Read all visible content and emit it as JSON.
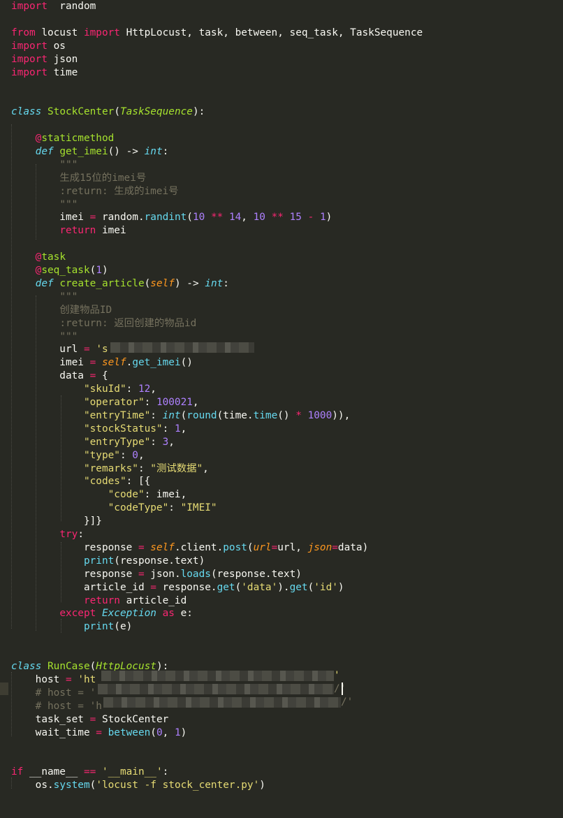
{
  "code_lines": [
    {
      "tokens": [
        [
          "kw",
          "import"
        ],
        [
          "",
          "  random"
        ]
      ]
    },
    {
      "tokens": []
    },
    {
      "tokens": [
        [
          "kw",
          "from"
        ],
        [
          "",
          " locust "
        ],
        [
          "kw",
          "import"
        ],
        [
          "",
          " HttpLocust, task, between, seq_task, TaskSequence"
        ]
      ]
    },
    {
      "tokens": [
        [
          "kw",
          "import"
        ],
        [
          "",
          " os"
        ]
      ]
    },
    {
      "tokens": [
        [
          "kw",
          "import"
        ],
        [
          "",
          " json"
        ]
      ]
    },
    {
      "tokens": [
        [
          "kw",
          "import"
        ],
        [
          "",
          " time"
        ]
      ]
    },
    {
      "tokens": []
    },
    {
      "tokens": []
    },
    {
      "tokens": [
        [
          "def",
          "class"
        ],
        [
          "",
          " "
        ],
        [
          "fn",
          "StockCenter"
        ],
        [
          "",
          "("
        ],
        [
          "ital",
          "TaskSequence"
        ],
        [
          "",
          "):"
        ]
      ]
    },
    {
      "tokens": []
    },
    {
      "tokens": [
        [
          "",
          "    "
        ],
        [
          "dec",
          "@"
        ],
        [
          "fn",
          "staticmethod"
        ]
      ]
    },
    {
      "tokens": [
        [
          "",
          "    "
        ],
        [
          "def",
          "def"
        ],
        [
          "",
          " "
        ],
        [
          "fn",
          "get_imei"
        ],
        [
          "",
          "() -> "
        ],
        [
          "def",
          "int"
        ],
        [
          "",
          ":"
        ]
      ]
    },
    {
      "tokens": [
        [
          "",
          "        "
        ],
        [
          "doc",
          "\"\"\""
        ]
      ]
    },
    {
      "tokens": [
        [
          "",
          "        "
        ],
        [
          "doc",
          "生成15位的imei号"
        ]
      ]
    },
    {
      "tokens": [
        [
          "",
          "        "
        ],
        [
          "doc",
          ":return: 生成的imei号"
        ]
      ]
    },
    {
      "tokens": [
        [
          "",
          "        "
        ],
        [
          "doc",
          "\"\"\""
        ]
      ]
    },
    {
      "tokens": [
        [
          "",
          "        imei "
        ],
        [
          "op",
          "="
        ],
        [
          "",
          " random."
        ],
        [
          "bi",
          "randint"
        ],
        [
          "",
          "("
        ],
        [
          "num",
          "10"
        ],
        [
          "",
          " "
        ],
        [
          "op",
          "**"
        ],
        [
          "",
          " "
        ],
        [
          "num",
          "14"
        ],
        [
          "",
          ", "
        ],
        [
          "num",
          "10"
        ],
        [
          "",
          " "
        ],
        [
          "op",
          "**"
        ],
        [
          "",
          " "
        ],
        [
          "num",
          "15"
        ],
        [
          "",
          " "
        ],
        [
          "op",
          "-"
        ],
        [
          "",
          " "
        ],
        [
          "num",
          "1"
        ],
        [
          "",
          ")"
        ]
      ]
    },
    {
      "tokens": [
        [
          "",
          "        "
        ],
        [
          "kw",
          "return"
        ],
        [
          "",
          " imei"
        ]
      ]
    },
    {
      "tokens": []
    },
    {
      "tokens": [
        [
          "",
          "    "
        ],
        [
          "dec",
          "@"
        ],
        [
          "fn",
          "task"
        ]
      ]
    },
    {
      "tokens": [
        [
          "",
          "    "
        ],
        [
          "dec",
          "@"
        ],
        [
          "fn",
          "seq_task"
        ],
        [
          "",
          "("
        ],
        [
          "num",
          "1"
        ],
        [
          "",
          ")"
        ]
      ]
    },
    {
      "tokens": [
        [
          "",
          "    "
        ],
        [
          "def",
          "def"
        ],
        [
          "",
          " "
        ],
        [
          "fn",
          "create_article"
        ],
        [
          "",
          "("
        ],
        [
          "param",
          "self"
        ],
        [
          "",
          ") -> "
        ],
        [
          "def",
          "int"
        ],
        [
          "",
          ":"
        ]
      ]
    },
    {
      "tokens": [
        [
          "",
          "        "
        ],
        [
          "doc",
          "\"\"\""
        ]
      ]
    },
    {
      "tokens": [
        [
          "",
          "        "
        ],
        [
          "doc",
          "创建物品ID"
        ]
      ]
    },
    {
      "tokens": [
        [
          "",
          "        "
        ],
        [
          "doc",
          ":return: 返回创建的物品id"
        ]
      ]
    },
    {
      "tokens": [
        [
          "",
          "        "
        ],
        [
          "doc",
          "\"\"\""
        ]
      ]
    },
    {
      "tokens": [
        [
          "",
          "        url "
        ],
        [
          "op",
          "="
        ],
        [
          "",
          " "
        ],
        [
          "str",
          "'s"
        ]
      ]
    },
    {
      "tokens": [
        [
          "",
          "        imei "
        ],
        [
          "op",
          "="
        ],
        [
          "",
          " "
        ],
        [
          "self",
          "self"
        ],
        [
          "",
          "."
        ],
        [
          "bi",
          "get_imei"
        ],
        [
          "",
          "()"
        ]
      ]
    },
    {
      "tokens": [
        [
          "",
          "        data "
        ],
        [
          "op",
          "="
        ],
        [
          "",
          " {"
        ]
      ]
    },
    {
      "tokens": [
        [
          "",
          "            "
        ],
        [
          "str",
          "\"skuId\""
        ],
        [
          "",
          ": "
        ],
        [
          "num",
          "12"
        ],
        [
          "",
          ","
        ]
      ]
    },
    {
      "tokens": [
        [
          "",
          "            "
        ],
        [
          "str",
          "\"operator\""
        ],
        [
          "",
          ": "
        ],
        [
          "num",
          "100021"
        ],
        [
          "",
          ","
        ]
      ]
    },
    {
      "tokens": [
        [
          "",
          "            "
        ],
        [
          "str",
          "\"entryTime\""
        ],
        [
          "",
          ": "
        ],
        [
          "def",
          "int"
        ],
        [
          "",
          "("
        ],
        [
          "bi",
          "round"
        ],
        [
          "",
          "(time."
        ],
        [
          "bi",
          "time"
        ],
        [
          "",
          "() "
        ],
        [
          "op",
          "*"
        ],
        [
          "",
          " "
        ],
        [
          "num",
          "1000"
        ],
        [
          "",
          ")),"
        ]
      ]
    },
    {
      "tokens": [
        [
          "",
          "            "
        ],
        [
          "str",
          "\"stockStatus\""
        ],
        [
          "",
          ": "
        ],
        [
          "num",
          "1"
        ],
        [
          "",
          ","
        ]
      ]
    },
    {
      "tokens": [
        [
          "",
          "            "
        ],
        [
          "str",
          "\"entryType\""
        ],
        [
          "",
          ": "
        ],
        [
          "num",
          "3"
        ],
        [
          "",
          ","
        ]
      ]
    },
    {
      "tokens": [
        [
          "",
          "            "
        ],
        [
          "str",
          "\"type\""
        ],
        [
          "",
          ": "
        ],
        [
          "num",
          "0"
        ],
        [
          "",
          ","
        ]
      ]
    },
    {
      "tokens": [
        [
          "",
          "            "
        ],
        [
          "str",
          "\"remarks\""
        ],
        [
          "",
          ": "
        ],
        [
          "str",
          "\"测试数据\""
        ],
        [
          "",
          ","
        ]
      ]
    },
    {
      "tokens": [
        [
          "",
          "            "
        ],
        [
          "str",
          "\"codes\""
        ],
        [
          "",
          ": [{"
        ]
      ]
    },
    {
      "tokens": [
        [
          "",
          "                "
        ],
        [
          "str",
          "\"code\""
        ],
        [
          "",
          ": imei,"
        ]
      ]
    },
    {
      "tokens": [
        [
          "",
          "                "
        ],
        [
          "str",
          "\"codeType\""
        ],
        [
          "",
          ": "
        ],
        [
          "str",
          "\"IMEI\""
        ]
      ]
    },
    {
      "tokens": [
        [
          "",
          "            }]}"
        ]
      ]
    },
    {
      "tokens": [
        [
          "",
          "        "
        ],
        [
          "kw",
          "try"
        ],
        [
          "",
          ":"
        ]
      ]
    },
    {
      "tokens": [
        [
          "",
          "            response "
        ],
        [
          "op",
          "="
        ],
        [
          "",
          " "
        ],
        [
          "self",
          "self"
        ],
        [
          "",
          ".client."
        ],
        [
          "bi",
          "post"
        ],
        [
          "",
          "("
        ],
        [
          "param",
          "url"
        ],
        [
          "op",
          "="
        ],
        [
          "",
          "url, "
        ],
        [
          "param",
          "json"
        ],
        [
          "op",
          "="
        ],
        [
          "",
          "data)"
        ]
      ]
    },
    {
      "tokens": [
        [
          "",
          "            "
        ],
        [
          "bi",
          "print"
        ],
        [
          "",
          "(response.text)"
        ]
      ]
    },
    {
      "tokens": [
        [
          "",
          "            response "
        ],
        [
          "op",
          "="
        ],
        [
          "",
          " json."
        ],
        [
          "bi",
          "loads"
        ],
        [
          "",
          "(response.text)"
        ]
      ]
    },
    {
      "tokens": [
        [
          "",
          "            article_id "
        ],
        [
          "op",
          "="
        ],
        [
          "",
          " response."
        ],
        [
          "bi",
          "get"
        ],
        [
          "",
          "("
        ],
        [
          "str",
          "'data'"
        ],
        [
          "",
          ")."
        ],
        [
          "bi",
          "get"
        ],
        [
          "",
          "("
        ],
        [
          "str",
          "'id'"
        ],
        [
          "",
          ")"
        ]
      ]
    },
    {
      "tokens": [
        [
          "",
          "            "
        ],
        [
          "kw",
          "return"
        ],
        [
          "",
          " article_id"
        ]
      ]
    },
    {
      "tokens": [
        [
          "",
          "        "
        ],
        [
          "kw",
          "except"
        ],
        [
          "",
          " "
        ],
        [
          "def",
          "Exception"
        ],
        [
          "",
          " "
        ],
        [
          "kw",
          "as"
        ],
        [
          "",
          " e:"
        ]
      ]
    },
    {
      "tokens": [
        [
          "",
          "            "
        ],
        [
          "bi",
          "print"
        ],
        [
          "",
          "(e)"
        ]
      ]
    },
    {
      "tokens": []
    },
    {
      "tokens": []
    },
    {
      "tokens": [
        [
          "def",
          "class"
        ],
        [
          "",
          " "
        ],
        [
          "fn",
          "RunCase"
        ],
        [
          "",
          "("
        ],
        [
          "ital",
          "HttpLocust"
        ],
        [
          "",
          "):"
        ]
      ]
    },
    {
      "tokens": [
        [
          "",
          "    host "
        ],
        [
          "op",
          "="
        ],
        [
          "",
          " "
        ],
        [
          "str",
          "'ht"
        ]
      ]
    },
    {
      "tokens": [
        [
          "",
          "    "
        ],
        [
          "com",
          "# host = '"
        ]
      ]
    },
    {
      "tokens": [
        [
          "",
          "    "
        ],
        [
          "com",
          "# host = 'h"
        ]
      ]
    },
    {
      "tokens": [
        [
          "",
          "    task_set "
        ],
        [
          "op",
          "="
        ],
        [
          "",
          " StockCenter"
        ]
      ]
    },
    {
      "tokens": [
        [
          "",
          "    wait_time "
        ],
        [
          "op",
          "="
        ],
        [
          "",
          " "
        ],
        [
          "bi",
          "between"
        ],
        [
          "",
          "("
        ],
        [
          "num",
          "0"
        ],
        [
          "",
          ", "
        ],
        [
          "num",
          "1"
        ],
        [
          "",
          ")"
        ]
      ]
    },
    {
      "tokens": []
    },
    {
      "tokens": []
    },
    {
      "tokens": [
        [
          "kw",
          "if"
        ],
        [
          "",
          " __name__ "
        ],
        [
          "op",
          "=="
        ],
        [
          "",
          " "
        ],
        [
          "str",
          "'__main__'"
        ],
        [
          "",
          ":"
        ]
      ]
    },
    {
      "tokens": [
        [
          "",
          "    os."
        ],
        [
          "bi",
          "system"
        ],
        [
          "",
          "("
        ],
        [
          "str",
          "'locust -f stock_center.py'"
        ],
        [
          "",
          ")"
        ]
      ]
    }
  ],
  "masked_tail": {
    "host_end": "'",
    "comment1_end": "/'",
    "comment2_end": "/'"
  }
}
